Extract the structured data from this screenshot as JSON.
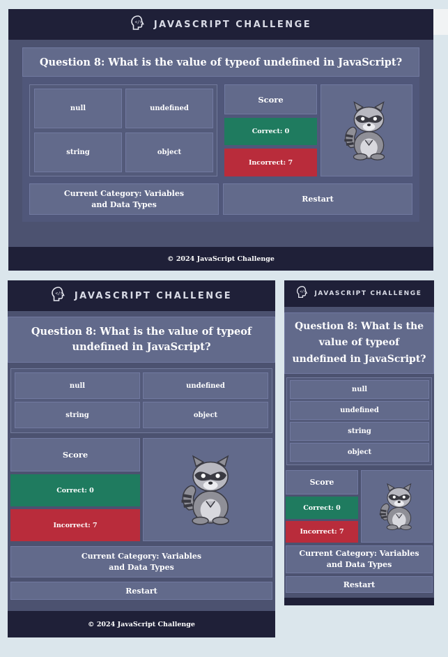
{
  "header": {
    "title": "JAVASCRIPT CHALLENGE"
  },
  "question": {
    "text": "Question 8: What is the value of typeof undefined in JavaScript?"
  },
  "answers": [
    "null",
    "undefined",
    "string",
    "object"
  ],
  "score": {
    "label": "Score",
    "correct": "Correct: 0",
    "incorrect": "Incorrect: 7"
  },
  "category": {
    "text": "Current Category: Variables and Data Types"
  },
  "restart": {
    "label": "Restart"
  },
  "footer": {
    "text": "© 2024 JavaScript Challenge"
  },
  "colors": {
    "header_bg": "#1f2038",
    "card_bg": "#626a8b",
    "page_bg": "#4c5270",
    "correct": "#1f7b5f",
    "incorrect": "#b92c3b"
  },
  "icons": {
    "logo": "brain-code-icon",
    "mascot": "raccoon-mascot"
  }
}
